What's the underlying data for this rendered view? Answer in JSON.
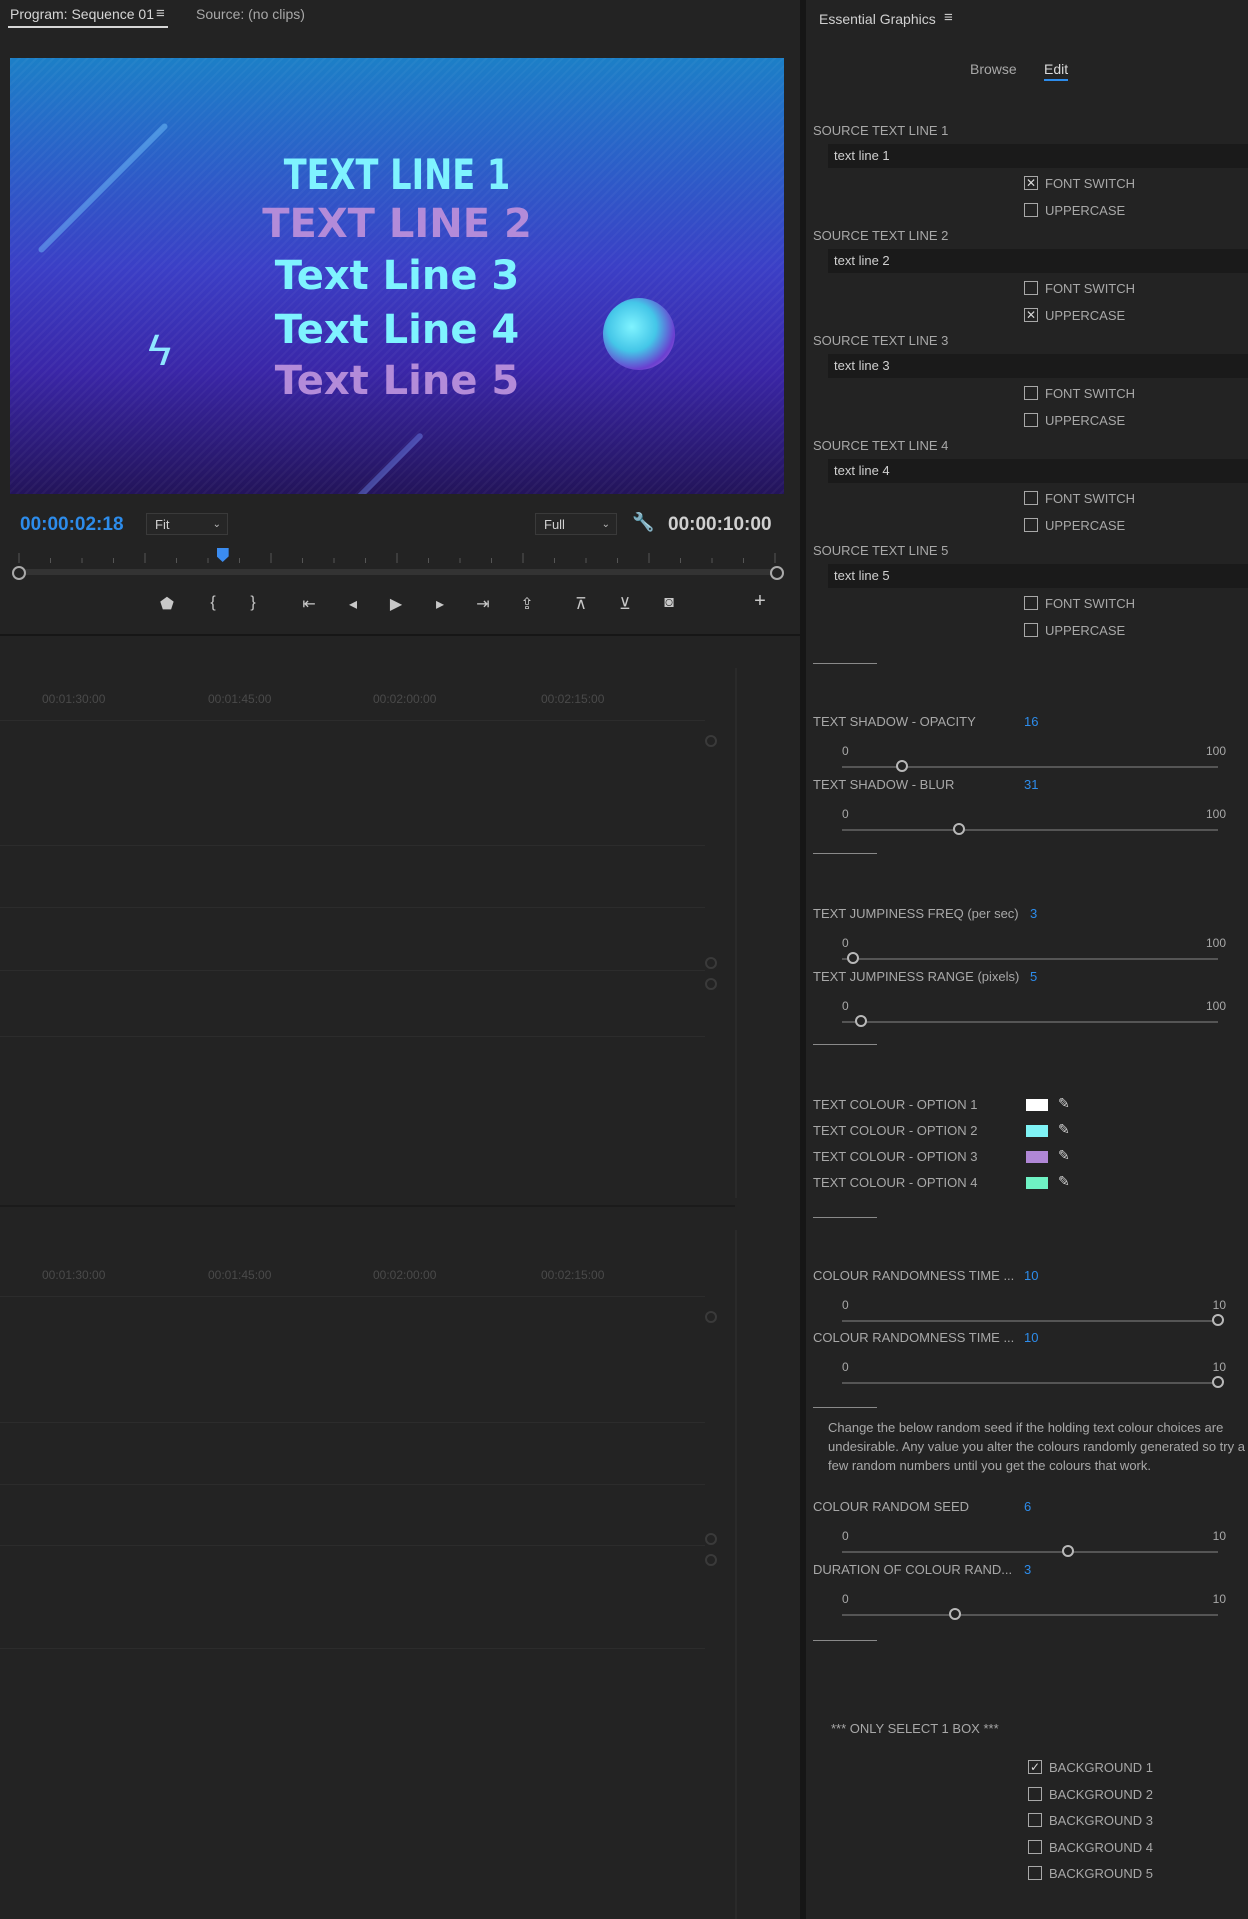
{
  "program_monitor": {
    "tab_program": "Program: Sequence 01",
    "tab_menu_icon": "hamburger-icon",
    "tab_source": "Source: (no clips)",
    "preview_lines": [
      "TEXT LINE 1",
      "TEXT LINE 2",
      "Text Line 3",
      "Text Line 4",
      "Text Line 5"
    ],
    "preview_line_colors": [
      "#7ff3ff",
      "#b38bd9",
      "#7ff3ff",
      "#7ff3ff",
      "#b38bd9"
    ],
    "current_time": "00:00:02:18",
    "zoom": "Fit",
    "resolution": "Full",
    "total_time": "00:00:10:00",
    "playhead_fraction": 0.27,
    "controls": [
      "marker-icon",
      "mark-in-icon",
      "mark-out-icon",
      "go-to-in-icon",
      "step-back-icon",
      "play-icon",
      "step-forward-icon",
      "go-to-out-icon",
      "lift-icon",
      "insert-icon",
      "overwrite-icon",
      "camera-icon",
      "add-button-icon"
    ]
  },
  "timeline": {
    "timecodes": [
      "00:01:30:00",
      "00:01:45:00",
      "00:02:00:00",
      "00:02:15:00"
    ]
  },
  "essential_graphics": {
    "title": "Essential Graphics",
    "tabs": {
      "browse": "Browse",
      "edit": "Edit"
    },
    "source_lines": [
      {
        "label": "SOURCE TEXT LINE 1",
        "value": "text line 1",
        "font_switch": true,
        "uppercase": false
      },
      {
        "label": "SOURCE TEXT LINE 2",
        "value": "text line 2",
        "font_switch": false,
        "uppercase": true
      },
      {
        "label": "SOURCE TEXT LINE 3",
        "value": "text line 3",
        "font_switch": false,
        "uppercase": false
      },
      {
        "label": "SOURCE TEXT LINE 4",
        "value": "text line 4",
        "font_switch": false,
        "uppercase": false
      },
      {
        "label": "SOURCE TEXT LINE 5",
        "value": "text line 5",
        "font_switch": false,
        "uppercase": false
      }
    ],
    "font_switch_label": "FONT SWITCH",
    "uppercase_label": "UPPERCASE",
    "sliders": [
      {
        "label": "TEXT SHADOW - OPACITY",
        "value": "16",
        "min": "0",
        "max": "100",
        "fraction": 0.16
      },
      {
        "label": "TEXT SHADOW - BLUR",
        "value": "31",
        "min": "0",
        "max": "100",
        "fraction": 0.31
      },
      {
        "label": "TEXT JUMPINESS FREQ (per sec)",
        "value": "3",
        "min": "0",
        "max": "100",
        "fraction": 0.03
      },
      {
        "label": "TEXT JUMPINESS RANGE (pixels)",
        "value": "5",
        "min": "0",
        "max": "100",
        "fraction": 0.05
      },
      {
        "label": "COLOUR RANDOMNESS TIME ...",
        "value": "10",
        "min": "0",
        "max": "10",
        "fraction": 1.0
      },
      {
        "label": "COLOUR RANDOMNESS TIME ...",
        "value": "10",
        "min": "0",
        "max": "10",
        "fraction": 1.0
      },
      {
        "label": "COLOUR RANDOM SEED",
        "value": "6",
        "min": "0",
        "max": "10",
        "fraction": 0.6
      },
      {
        "label": "DURATION OF COLOUR RAND...",
        "value": "3",
        "min": "0",
        "max": "10",
        "fraction": 0.3
      }
    ],
    "colours": [
      {
        "label": "TEXT COLOUR - OPTION 1",
        "color": "#ffffff"
      },
      {
        "label": "TEXT COLOUR - OPTION 2",
        "color": "#7ff3f5"
      },
      {
        "label": "TEXT COLOUR - OPTION 3",
        "color": "#b087d6"
      },
      {
        "label": "TEXT COLOUR - OPTION 4",
        "color": "#6ff2c4"
      }
    ],
    "note": "Change the below random seed if the holding text colour choices are undesirable. Any value you alter the colours randomly generated so try a few random numbers until you get the colours that work.",
    "only_select": "*** ONLY SELECT 1 BOX ***",
    "backgrounds": [
      {
        "label": "BACKGROUND 1",
        "checked": true
      },
      {
        "label": "BACKGROUND 2",
        "checked": false
      },
      {
        "label": "BACKGROUND 3",
        "checked": false
      },
      {
        "label": "BACKGROUND 4",
        "checked": false
      },
      {
        "label": "BACKGROUND 5",
        "checked": false
      }
    ]
  }
}
